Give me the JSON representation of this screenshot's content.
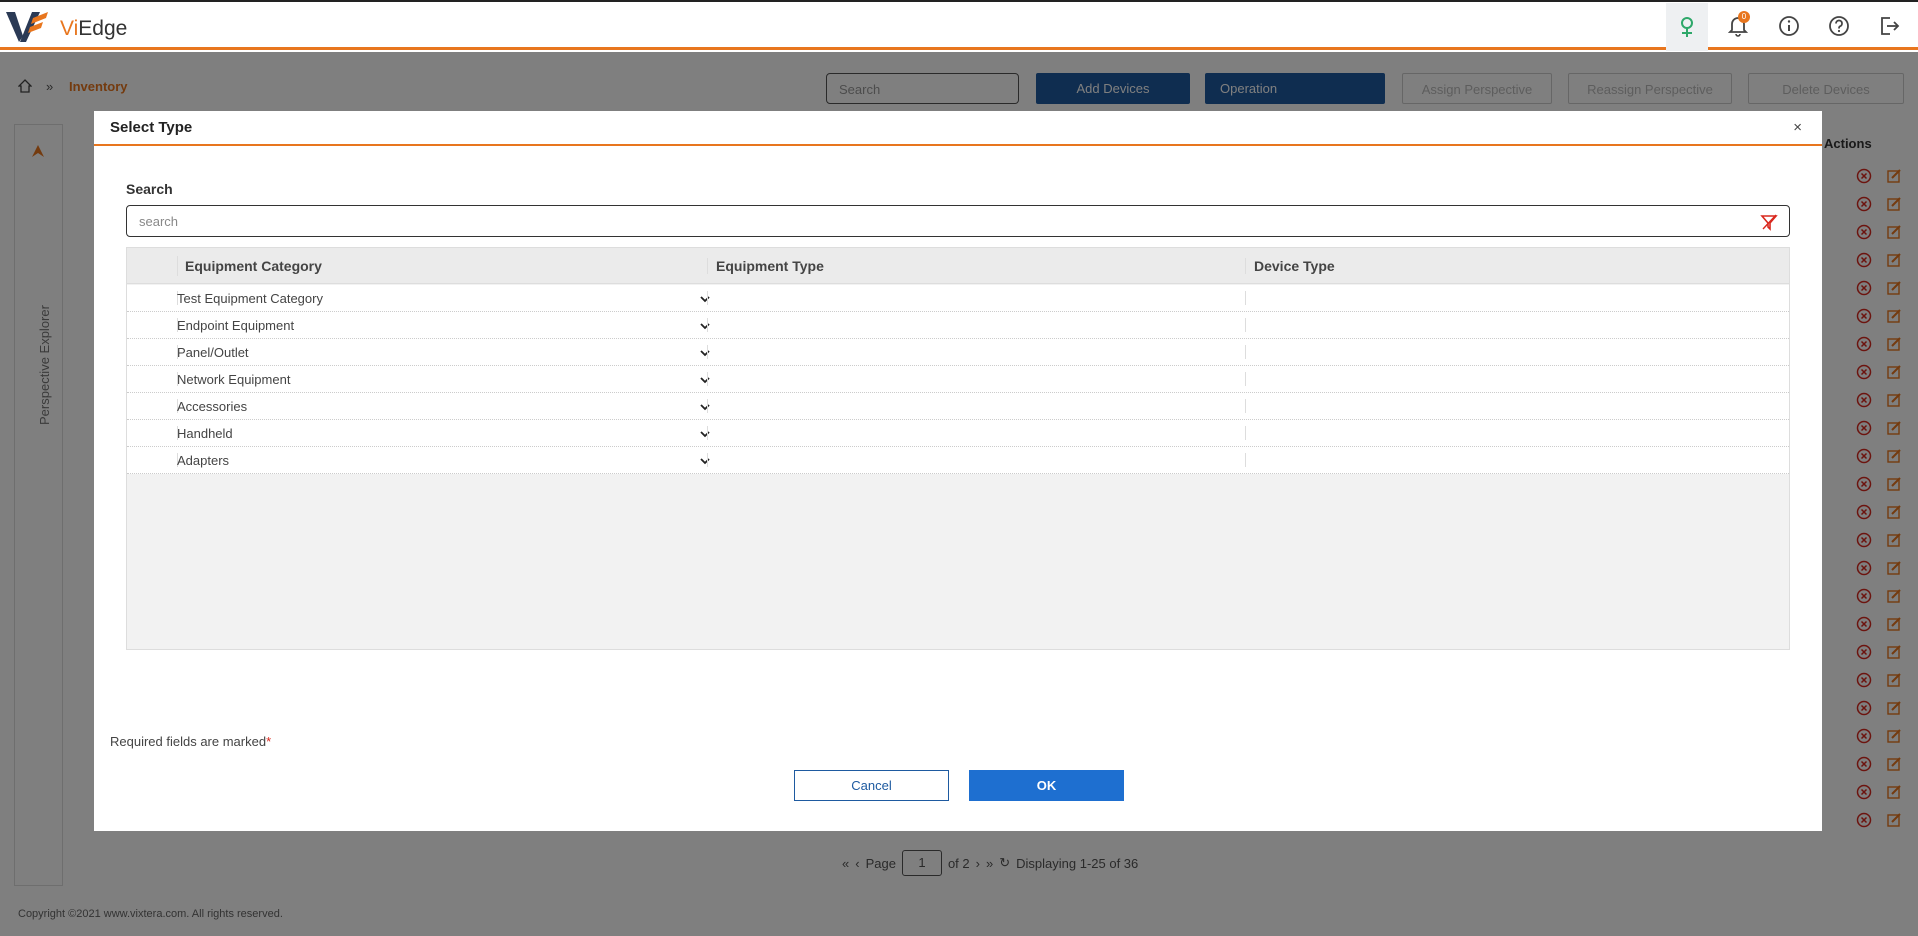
{
  "app": {
    "name_prefix": "Vi",
    "name_suffix": "Edge"
  },
  "header": {
    "notification_count": "0"
  },
  "breadcrumb": {
    "current": "Inventory"
  },
  "toolbar": {
    "search_placeholder": "Search",
    "add_devices": "Add Devices",
    "operation": "Operation",
    "assign_perspective": "Assign Perspective",
    "reassign_perspective": "Reassign Perspective",
    "delete_devices": "Delete Devices"
  },
  "sidebar": {
    "label": "Perspective Explorer"
  },
  "table": {
    "actions_header": "Actions",
    "row_count": 24
  },
  "pager": {
    "page_label": "Page",
    "page": "1",
    "of_label": "of 2",
    "displaying": "Displaying 1-25 of 36"
  },
  "footer": {
    "copyright": "Copyright ©2021 www.vixtera.com. All rights reserved."
  },
  "dialog": {
    "title": "Select Type",
    "close": "×",
    "search_label": "Search",
    "search_placeholder": "search",
    "columns": [
      "Equipment Category",
      "Equipment Type",
      "Device Type"
    ],
    "rows": [
      "Test Equipment Category",
      "Endpoint Equipment",
      "Panel/Outlet",
      "Network Equipment",
      "Accessories",
      "Handheld",
      "Adapters"
    ],
    "required_note": "Required fields are marked",
    "required_star": "*",
    "cancel": "Cancel",
    "ok": "OK"
  },
  "colors": {
    "accent": "#e8761e",
    "primary": "#1e5aa0",
    "ok": "#1e6fd0",
    "required": "#d9281e"
  }
}
